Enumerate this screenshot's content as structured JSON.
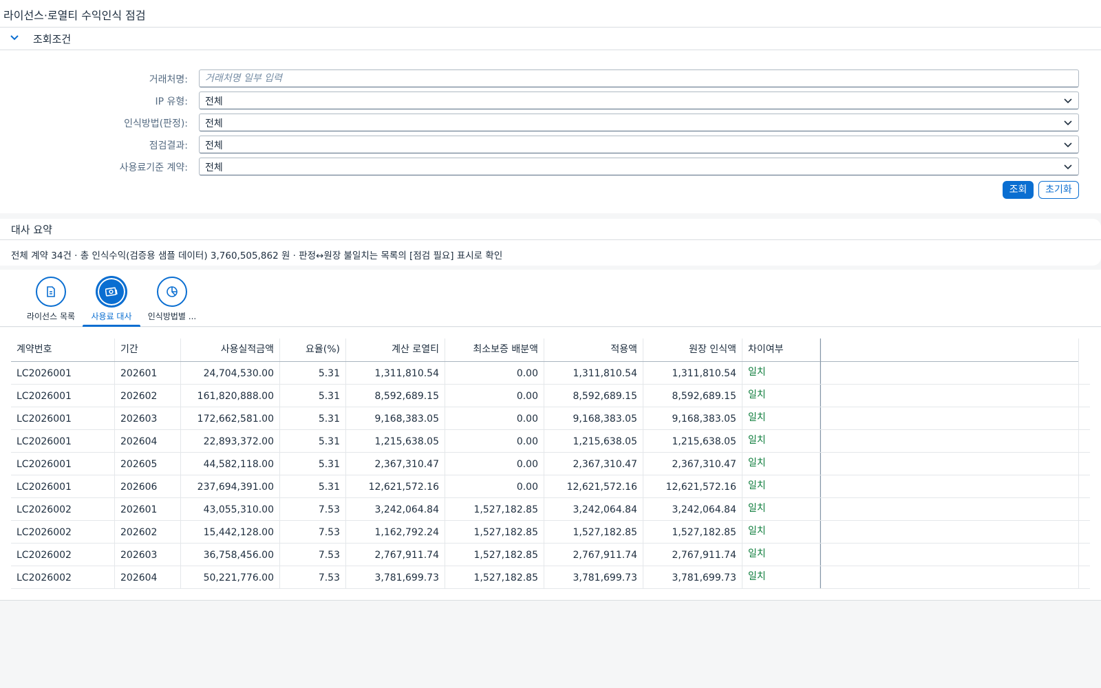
{
  "page_title": "라이선스·로열티 수익인식 점검",
  "filter_panel": {
    "title": "조회조건",
    "fields": {
      "partner": {
        "label": "거래처명:",
        "placeholder": "거래처명 일부 입력",
        "value": ""
      },
      "ip_type": {
        "label": "IP 유형:",
        "value": "전체"
      },
      "method": {
        "label": "인식방법(판정):",
        "value": "전체"
      },
      "result": {
        "label": "점검결과:",
        "value": "전체"
      },
      "usage_contract": {
        "label": "사용료기준 계약:",
        "value": "전체"
      }
    },
    "search_label": "조회",
    "reset_label": "초기화"
  },
  "summary": {
    "title": "대사 요약",
    "text": "전체 계약 34건 · 총 인식수익(검증용 샘플 데이터) 3,760,505,862 원 · 판정↔원장 불일치는 목록의 [점검 필요] 표시로 확인"
  },
  "tabs": [
    {
      "label": "라이선스 목록",
      "icon": "document-icon"
    },
    {
      "label": "사용료 대사",
      "icon": "money-icon"
    },
    {
      "label": "인식방법별 ...",
      "icon": "pie-chart-icon"
    }
  ],
  "table": {
    "columns": [
      "계약번호",
      "기간",
      "사용실적금액",
      "요율(%)",
      "계산 로열티",
      "최소보증 배분액",
      "적용액",
      "원장 인식액",
      "차이여부"
    ],
    "rows": [
      [
        "LC2026001",
        "202601",
        "24,704,530.00",
        "5.31",
        "1,311,810.54",
        "0.00",
        "1,311,810.54",
        "1,311,810.54",
        "일치"
      ],
      [
        "LC2026001",
        "202602",
        "161,820,888.00",
        "5.31",
        "8,592,689.15",
        "0.00",
        "8,592,689.15",
        "8,592,689.15",
        "일치"
      ],
      [
        "LC2026001",
        "202603",
        "172,662,581.00",
        "5.31",
        "9,168,383.05",
        "0.00",
        "9,168,383.05",
        "9,168,383.05",
        "일치"
      ],
      [
        "LC2026001",
        "202604",
        "22,893,372.00",
        "5.31",
        "1,215,638.05",
        "0.00",
        "1,215,638.05",
        "1,215,638.05",
        "일치"
      ],
      [
        "LC2026001",
        "202605",
        "44,582,118.00",
        "5.31",
        "2,367,310.47",
        "0.00",
        "2,367,310.47",
        "2,367,310.47",
        "일치"
      ],
      [
        "LC2026001",
        "202606",
        "237,694,391.00",
        "5.31",
        "12,621,572.16",
        "0.00",
        "12,621,572.16",
        "12,621,572.16",
        "일치"
      ],
      [
        "LC2026002",
        "202601",
        "43,055,310.00",
        "7.53",
        "3,242,064.84",
        "1,527,182.85",
        "3,242,064.84",
        "3,242,064.84",
        "일치"
      ],
      [
        "LC2026002",
        "202602",
        "15,442,128.00",
        "7.53",
        "1,162,792.24",
        "1,527,182.85",
        "1,527,182.85",
        "1,527,182.85",
        "일치"
      ],
      [
        "LC2026002",
        "202603",
        "36,758,456.00",
        "7.53",
        "2,767,911.74",
        "1,527,182.85",
        "2,767,911.74",
        "2,767,911.74",
        "일치"
      ],
      [
        "LC2026002",
        "202604",
        "50,221,776.00",
        "7.53",
        "3,781,699.73",
        "1,527,182.85",
        "3,781,699.73",
        "3,781,699.73",
        "일치"
      ]
    ]
  },
  "colors": {
    "accent": "#0a6ed1",
    "match": "#107e3e"
  }
}
